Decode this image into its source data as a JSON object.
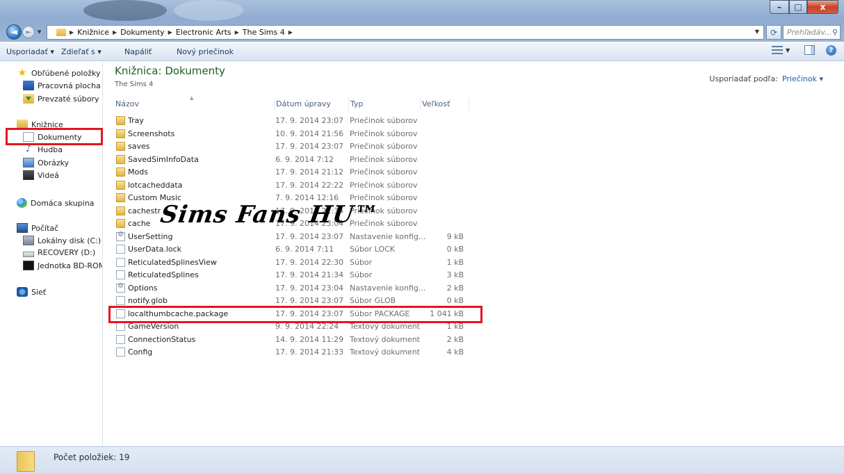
{
  "window": {
    "min_symbol": "–",
    "max_symbol": "□",
    "close_symbol": "x"
  },
  "address": {
    "crumbs": [
      "Knižnice",
      "Dokumenty",
      "Electronic Arts",
      "The Sims 4"
    ],
    "search_placeholder": "Prehľadáv..."
  },
  "toolbar": {
    "organize": "Usporiadať ▾",
    "share": "Zdieľať s ▾",
    "burn": "Napáliť",
    "new_folder": "Nový priečinok",
    "help_symbol": "?"
  },
  "sidebar": {
    "favorites": "Obľúbené položky",
    "desktop": "Pracovná plocha",
    "downloads": "Prevzaté súbory",
    "libraries": "Knižnice",
    "documents": "Dokumenty",
    "music": "Hudba",
    "pictures": "Obrázky",
    "videos": "Videá",
    "homegroup": "Domáca skupina",
    "computer": "Počítač",
    "local_disk": "Lokálny disk (C:)",
    "recovery": "RECOVERY (D:)",
    "bd_rom": "Jednotka BD-ROM (F",
    "network": "Sieť"
  },
  "main": {
    "title": "Knižnica: Dokumenty",
    "subtitle": "The Sims 4",
    "arrange_label": "Usporiadať podľa:",
    "arrange_value": "Priečinok ▾",
    "columns": {
      "name": "Názov",
      "date": "Dátum úpravy",
      "type": "Typ",
      "size": "Veľkosť"
    },
    "watermark": "Sims Fans HU™",
    "rows": [
      {
        "name": "Tray",
        "date": "17. 9. 2014 23:07",
        "type": "Priečinok súborov",
        "size": "",
        "icon": "folder"
      },
      {
        "name": "Screenshots",
        "date": "10. 9. 2014 21:56",
        "type": "Priečinok súborov",
        "size": "",
        "icon": "folder"
      },
      {
        "name": "saves",
        "date": "17. 9. 2014 23:07",
        "type": "Priečinok súborov",
        "size": "",
        "icon": "folder"
      },
      {
        "name": "SavedSimInfoData",
        "date": "6. 9. 2014 7:12",
        "type": "Priečinok súborov",
        "size": "",
        "icon": "folder"
      },
      {
        "name": "Mods",
        "date": "17. 9. 2014 21:12",
        "type": "Priečinok súborov",
        "size": "",
        "icon": "folder"
      },
      {
        "name": "lotcacheddata",
        "date": "17. 9. 2014 22:22",
        "type": "Priečinok súborov",
        "size": "",
        "icon": "folder"
      },
      {
        "name": "Custom Music",
        "date": "7. 9. 2014 12:16",
        "type": "Priečinok súborov",
        "size": "",
        "icon": "folder"
      },
      {
        "name": "cachestr",
        "date": "17. 9. 2014 21:34",
        "type": "Priečinok súborov",
        "size": "",
        "icon": "folder"
      },
      {
        "name": "cache",
        "date": "17. 9. 2014 23:04",
        "type": "Priečinok súborov",
        "size": "",
        "icon": "folder"
      },
      {
        "name": "UserSetting",
        "date": "17. 9. 2014 23:07",
        "type": "Nastavenie konfig...",
        "size": "9 kB",
        "icon": "cfg"
      },
      {
        "name": "UserData.lock",
        "date": "6. 9. 2014 7:11",
        "type": "Súbor LOCK",
        "size": "0 kB",
        "icon": "file"
      },
      {
        "name": "ReticulatedSplinesView",
        "date": "17. 9. 2014 22:30",
        "type": "Súbor",
        "size": "1 kB",
        "icon": "file"
      },
      {
        "name": "ReticulatedSplines",
        "date": "17. 9. 2014 21:34",
        "type": "Súbor",
        "size": "3 kB",
        "icon": "file"
      },
      {
        "name": "Options",
        "date": "17. 9. 2014 23:04",
        "type": "Nastavenie konfig...",
        "size": "2 kB",
        "icon": "cfg"
      },
      {
        "name": "notify.glob",
        "date": "17. 9. 2014 23:07",
        "type": "Súbor GLOB",
        "size": "0 kB",
        "icon": "file"
      },
      {
        "name": "localthumbcache.package",
        "date": "17. 9. 2014 23:07",
        "type": "Súbor PACKAGE",
        "size": "1 041 kB",
        "icon": "file"
      },
      {
        "name": "GameVersion",
        "date": "9. 9. 2014 22:24",
        "type": "Textový dokument",
        "size": "1 kB",
        "icon": "file"
      },
      {
        "name": "ConnectionStatus",
        "date": "14. 9. 2014 11:29",
        "type": "Textový dokument",
        "size": "2 kB",
        "icon": "file"
      },
      {
        "name": "Config",
        "date": "17. 9. 2014 21:33",
        "type": "Textový dokument",
        "size": "4 kB",
        "icon": "file"
      }
    ]
  },
  "status": {
    "text": "Počet položiek: 19"
  },
  "colors": {
    "highlight": "#e2151f",
    "library_title": "#1e5d1e"
  }
}
